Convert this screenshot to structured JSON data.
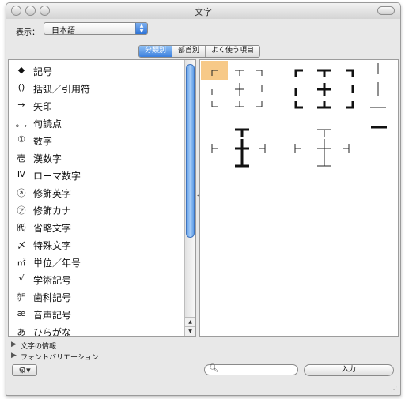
{
  "window": {
    "title": "文字"
  },
  "display": {
    "label": "表示：",
    "selected": "日本語"
  },
  "tabs": [
    {
      "label": "分類別",
      "active": true
    },
    {
      "label": "部首別",
      "active": false
    },
    {
      "label": "よく使う項目",
      "active": false
    }
  ],
  "categories": [
    {
      "icon": "◆",
      "label": "記号"
    },
    {
      "icon": "()",
      "label": "括弧／引用符"
    },
    {
      "icon": "→",
      "label": "矢印"
    },
    {
      "icon": "。,",
      "label": "句読点"
    },
    {
      "icon": "①",
      "label": "数字"
    },
    {
      "icon": "壱",
      "label": "漢数字"
    },
    {
      "icon": "Ⅳ",
      "label": "ローマ数字"
    },
    {
      "icon": "ⓐ",
      "label": "修飾英字"
    },
    {
      "icon": "㋐",
      "label": "修飾カナ"
    },
    {
      "icon": "㈹",
      "label": "省略文字"
    },
    {
      "icon": "〆",
      "label": "特殊文字"
    },
    {
      "icon": "㎡",
      "label": "単位／年号"
    },
    {
      "icon": "√",
      "label": "学術記号"
    },
    {
      "icon": "㌍",
      "label": "歯科記号"
    },
    {
      "icon": "æ",
      "label": "音声記号"
    },
    {
      "icon": "あ",
      "label": "ひらがな"
    }
  ],
  "bottom": {
    "info_label": "文字の情報",
    "font_variation_label": "フォントバリエーション",
    "insert_label": "入力"
  },
  "colors": {
    "accent": "#3b7fdd",
    "selection": "#f7c988"
  }
}
